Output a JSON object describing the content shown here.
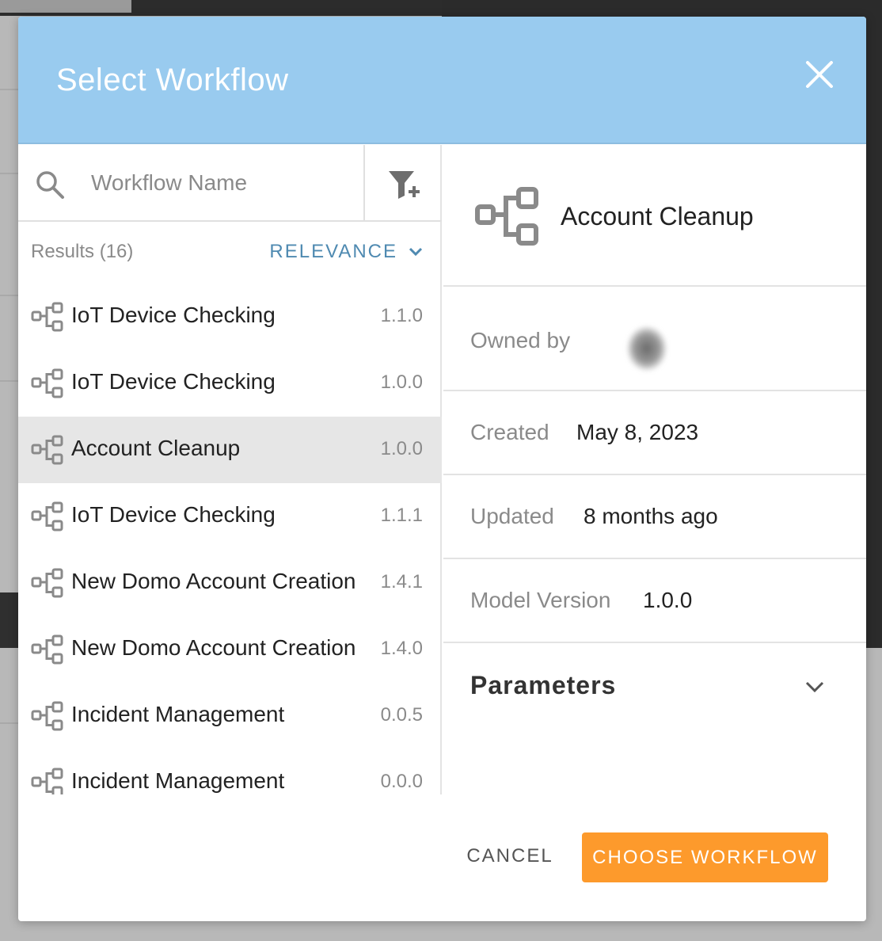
{
  "modal": {
    "title": "Select Workflow"
  },
  "search": {
    "placeholder": "Workflow Name",
    "value": ""
  },
  "results": {
    "count_label": "Results (16)",
    "sort_label": "RELEVANCE"
  },
  "workflows": [
    {
      "name": "IoT Device Checking",
      "version": "1.1.0",
      "selected": false
    },
    {
      "name": "IoT Device Checking",
      "version": "1.0.0",
      "selected": false
    },
    {
      "name": "Account Cleanup",
      "version": "1.0.0",
      "selected": true
    },
    {
      "name": "IoT Device Checking",
      "version": "1.1.1",
      "selected": false
    },
    {
      "name": "New Domo Account Creation",
      "version": "1.4.1",
      "selected": false
    },
    {
      "name": "New Domo Account Creation",
      "version": "1.4.0",
      "selected": false
    },
    {
      "name": "Incident Management",
      "version": "0.0.5",
      "selected": false
    },
    {
      "name": "Incident Management",
      "version": "0.0.0",
      "selected": false
    }
  ],
  "detail": {
    "title": "Account Cleanup",
    "owned_by_label": "Owned by",
    "created_label": "Created",
    "created_value": "May 8, 2023",
    "updated_label": "Updated",
    "updated_value": "8 months ago",
    "model_version_label": "Model Version",
    "model_version_value": "1.0.0",
    "parameters_label": "Parameters"
  },
  "footer": {
    "cancel_label": "CANCEL",
    "choose_label": "CHOOSE WORKFLOW"
  },
  "colors": {
    "header_bg": "#99cbef",
    "accent_sort": "#4f8ab1",
    "primary_button": "#fd9a2c",
    "selected_row": "#e6e6e6"
  },
  "icons": {
    "close": "close-icon",
    "search": "search-icon",
    "filter": "filter-add-icon",
    "sort": "chevron-down-icon",
    "workflow": "workflow-icon",
    "parameters": "chevron-down-icon"
  }
}
